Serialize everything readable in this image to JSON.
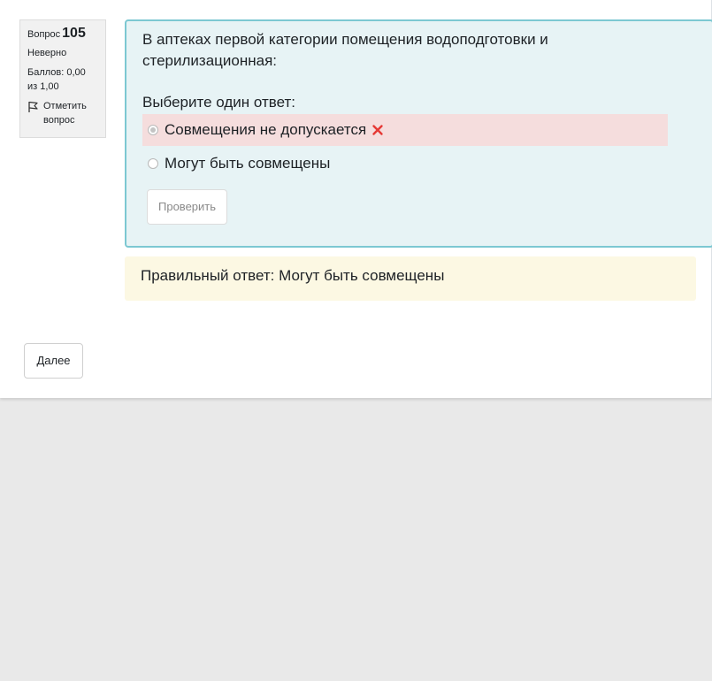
{
  "question_info": {
    "label": "Вопрос",
    "number": "105",
    "state": "Неверно",
    "grade": "Баллов: 0,00 из 1,00",
    "flag_label": "Отметить вопрос"
  },
  "question": {
    "text": "В аптеках первой категории помещения водоподготовки и стерилизационная:",
    "prompt": "Выберите один ответ:",
    "answers": [
      {
        "label": "Совмещения не допускается",
        "selected": true,
        "result": "incorrect"
      },
      {
        "label": "Могут быть совмещены",
        "selected": false,
        "result": ""
      }
    ],
    "check_button": "Проверить"
  },
  "feedback": {
    "right_answer": "Правильный ответ: Могут быть совмещены"
  },
  "navigation": {
    "next_button": "Далее"
  },
  "colors": {
    "formulation_bg": "#e7f3f5",
    "formulation_border": "#7cc8d2",
    "incorrect_bg": "#f5dddd",
    "incorrect_icon": "#e53935",
    "feedback_bg": "#fcf8e3"
  }
}
